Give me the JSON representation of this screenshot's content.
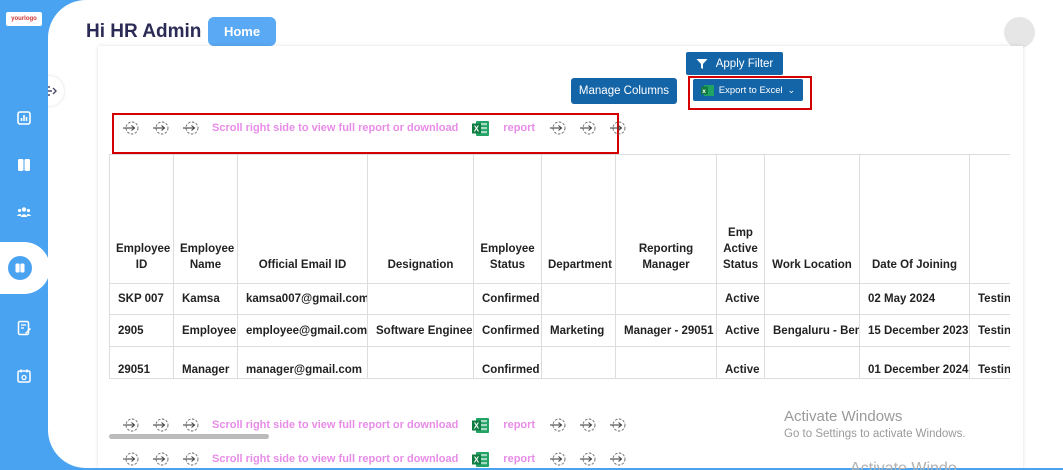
{
  "logo": {
    "text": "yourlogo"
  },
  "header": {
    "greeting": "Hi HR Admin",
    "home_label": "Home"
  },
  "toolbar": {
    "apply_filter_label": "Apply Filter",
    "manage_columns_label": "Manage Columns",
    "export_label": "Export to Excel",
    "export_caret": "⌄"
  },
  "scroll_hint": {
    "text": "Scroll right side to view full report or download",
    "report_label": "report"
  },
  "table": {
    "columns": [
      "Employee ID",
      "Employee Name",
      "Official Email ID",
      "Designation",
      "Employee Status",
      "Department",
      "Reporting Manager",
      "Emp Active Status",
      "Work Location",
      "Date Of Joining",
      ""
    ],
    "rows": [
      [
        "SKP 007",
        "Kamsa",
        "kamsa007@gmail.com",
        "",
        "Confirmed",
        "",
        "",
        "Active",
        "",
        "02 May 2024",
        "Testing"
      ],
      [
        "2905",
        "Employee",
        "employee@gmail.com",
        "Software Engineer",
        "Confirmed",
        "Marketing",
        "Manager - 29051",
        "Active",
        "Bengaluru - Ben",
        "15 December 2023",
        "Testing"
      ],
      [
        "29051",
        "Manager",
        "manager@gmail.com",
        "",
        "Confirmed",
        "",
        "",
        "Active",
        "",
        "01 December 2024",
        "Testing"
      ]
    ]
  },
  "watermark": {
    "line1": "Activate Windows",
    "line2": "Go to Settings to activate Windows.",
    "line3": "Activate Windo"
  },
  "colors": {
    "accent": "#4aa3f0",
    "button": "#1465a8",
    "highlight": "#d40000",
    "hint_text": "#e88ce8"
  }
}
